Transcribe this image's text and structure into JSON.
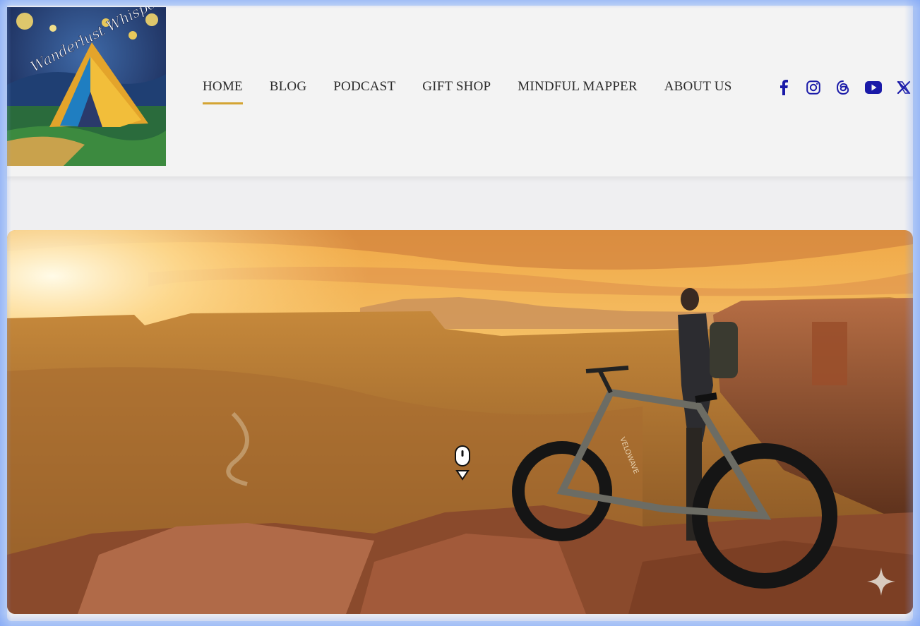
{
  "site": {
    "logo_text": "Wanderlust Whisperz",
    "logo_alt": "Wanderlust Whisperz logo"
  },
  "nav": {
    "items": [
      {
        "label": "HOME",
        "active": true
      },
      {
        "label": "BLOG",
        "active": false
      },
      {
        "label": "PODCAST",
        "active": false
      },
      {
        "label": "GIFT SHOP",
        "active": false
      },
      {
        "label": "MINDFUL MAPPER",
        "active": false
      },
      {
        "label": "ABOUT US",
        "active": false
      }
    ],
    "accent_color": "#d4a433"
  },
  "social": {
    "icons": [
      "facebook-icon",
      "instagram-icon",
      "threads-icon",
      "youtube-icon",
      "x-icon"
    ],
    "color": "#1a1aa8"
  },
  "hero": {
    "alt": "Cyclist with a fat-tire e-bike overlooking a canyon at sunset",
    "bike_brand": "VELOWAVE"
  },
  "colors": {
    "header_bg": "#f3f3f3",
    "page_bg": "#efeff1",
    "frame_glow": "#7aa0f5"
  }
}
